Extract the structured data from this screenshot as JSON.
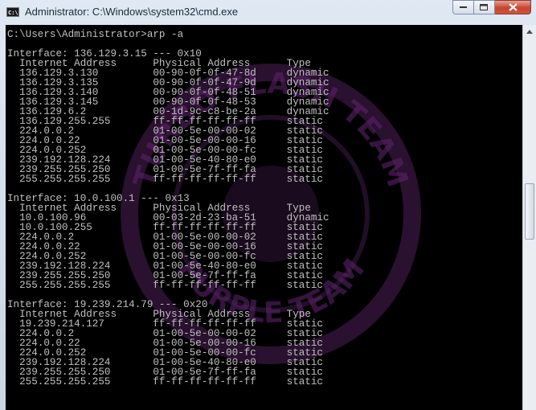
{
  "window": {
    "title": "Administrator: C:\\Windows\\system32\\cmd.exe",
    "icon_label": "C:\\",
    "buttons": {
      "minimize": "minimize-icon",
      "maximize": "maximize-icon",
      "close": "close-icon"
    }
  },
  "console": {
    "prompt": "C:\\Users\\Administrator>arp -a",
    "interfaces": [
      {
        "header": "Interface: 136.129.3.15 --- 0x10",
        "columns": [
          "Internet Address",
          "Physical Address",
          "Type"
        ],
        "rows": [
          [
            "136.129.3.130",
            "00-90-0f-0f-47-8d",
            "dynamic"
          ],
          [
            "136.129.3.135",
            "00-90-0f-0f-47-9d",
            "dynamic"
          ],
          [
            "136.129.3.140",
            "00-90-0f-0f-48-51",
            "dynamic"
          ],
          [
            "136.129.3.145",
            "00-90-0f-0f-48-53",
            "dynamic"
          ],
          [
            "136.129.6.2",
            "00-1d-9c-c8-be-2a",
            "dynamic"
          ],
          [
            "136.129.255.255",
            "ff-ff-ff-ff-ff-ff",
            "static"
          ],
          [
            "224.0.0.2",
            "01-00-5e-00-00-02",
            "static"
          ],
          [
            "224.0.0.22",
            "01-00-5e-00-00-16",
            "static"
          ],
          [
            "224.0.0.252",
            "01-00-5e-00-00-fc",
            "static"
          ],
          [
            "239.192.128.224",
            "01-00-5e-40-80-e0",
            "static"
          ],
          [
            "239.255.255.250",
            "01-00-5e-7f-ff-fa",
            "static"
          ],
          [
            "255.255.255.255",
            "ff-ff-ff-ff-ff-ff",
            "static"
          ]
        ]
      },
      {
        "header": "Interface: 10.0.100.1 --- 0x13",
        "columns": [
          "Internet Address",
          "Physical Address",
          "Type"
        ],
        "rows": [
          [
            "10.0.100.96",
            "00-03-2d-23-ba-51",
            "dynamic"
          ],
          [
            "10.0.100.255",
            "ff-ff-ff-ff-ff-ff",
            "static"
          ],
          [
            "224.0.0.2",
            "01-00-5e-00-00-02",
            "static"
          ],
          [
            "224.0.0.22",
            "01-00-5e-00-00-16",
            "static"
          ],
          [
            "224.0.0.252",
            "01-00-5e-00-00-fc",
            "static"
          ],
          [
            "239.192.128.224",
            "01-00-5e-40-80-e0",
            "static"
          ],
          [
            "239.255.255.250",
            "01-00-5e-7f-ff-fa",
            "static"
          ],
          [
            "255.255.255.255",
            "ff-ff-ff-ff-ff-ff",
            "static"
          ]
        ]
      },
      {
        "header": "Interface: 19.239.214.79 --- 0x20",
        "columns": [
          "Internet Address",
          "Physical Address",
          "Type"
        ],
        "rows": [
          [
            "19.239.214.127",
            "ff-ff-ff-ff-ff-ff",
            "static"
          ],
          [
            "224.0.0.2",
            "01-00-5e-00-00-02",
            "static"
          ],
          [
            "224.0.0.22",
            "01-00-5e-00-00-16",
            "static"
          ],
          [
            "224.0.0.252",
            "01-00-5e-00-00-fc",
            "static"
          ],
          [
            "239.192.128.224",
            "01-00-5e-40-80-e0",
            "static"
          ],
          [
            "239.255.255.250",
            "01-00-5e-7f-ff-fa",
            "static"
          ],
          [
            "255.255.255.255",
            "ff-ff-ff-ff-ff-ff",
            "static"
          ]
        ]
      }
    ]
  },
  "watermark": {
    "top_text": "TURBO FLASH TEAM",
    "bottom_text": "PURPLE TEAM",
    "color": "#6a2a78"
  },
  "colors": {
    "console_bg": "#000000",
    "console_text": "#c0c0c0",
    "titlebar": "#dfe8f3"
  }
}
